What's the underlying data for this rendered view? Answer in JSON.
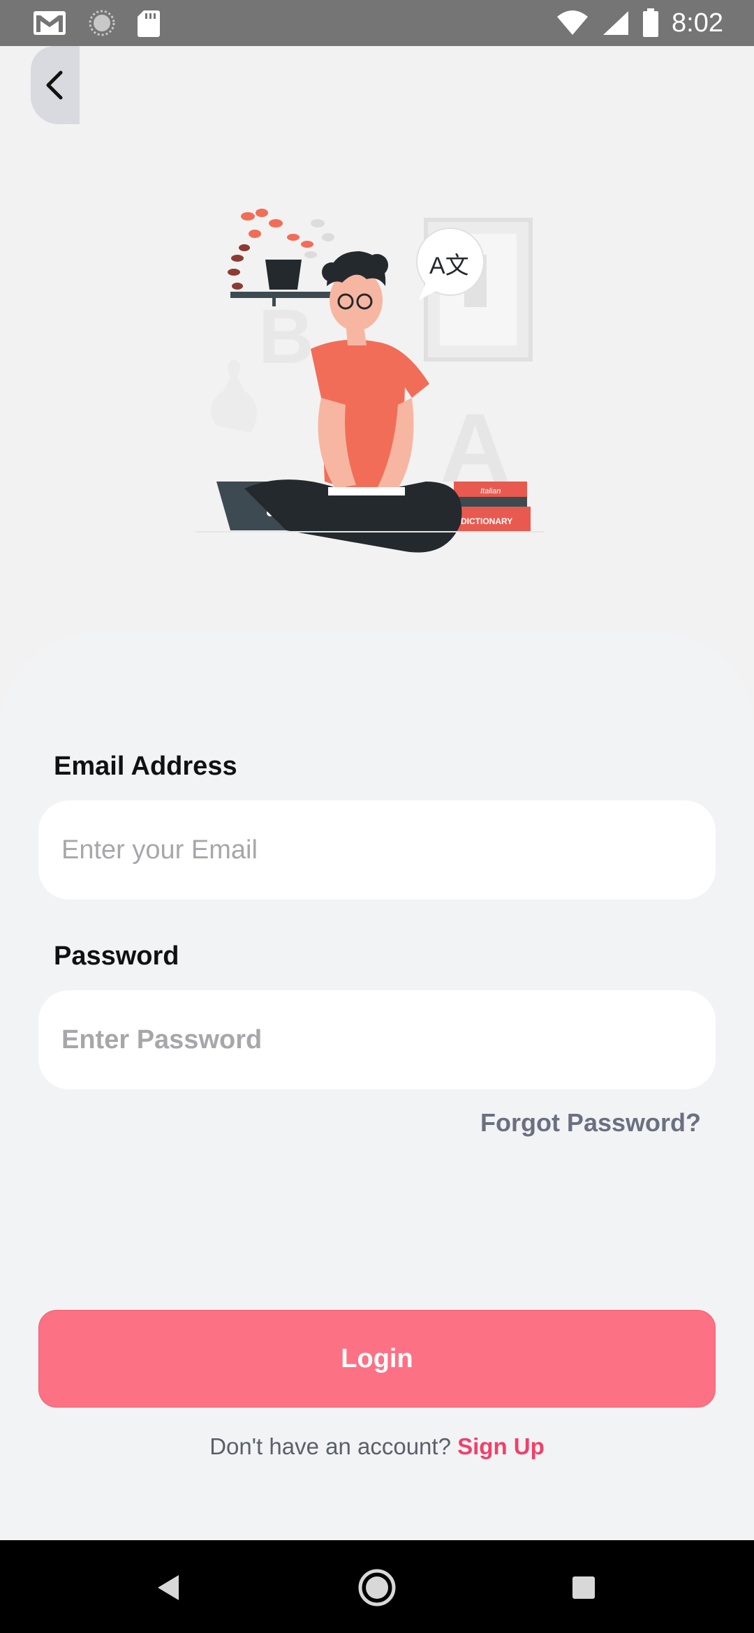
{
  "status_bar": {
    "time": "8:02",
    "icons": [
      "gmail-icon",
      "sync-icon",
      "sd-card-icon",
      "wifi-icon",
      "signal-icon",
      "battery-icon"
    ]
  },
  "illustration": {
    "speech_glyph": "A文",
    "book_label_1": "Italian",
    "book_label_2": "DICTIONARY",
    "bg_letter_1": "B",
    "bg_letter_2": "A"
  },
  "form": {
    "email_label": "Email Address",
    "email_placeholder": "Enter your Email",
    "password_label": "Password",
    "password_placeholder": "Enter Password",
    "forgot_label": "Forgot Password?",
    "login_label": "Login",
    "signup_prompt": "Don't have an account? ",
    "signup_link": "Sign Up"
  },
  "colors": {
    "accent": "#fd7184",
    "link": "#f0406a",
    "background": "#f2f2f2",
    "status_bar": "#757575"
  }
}
